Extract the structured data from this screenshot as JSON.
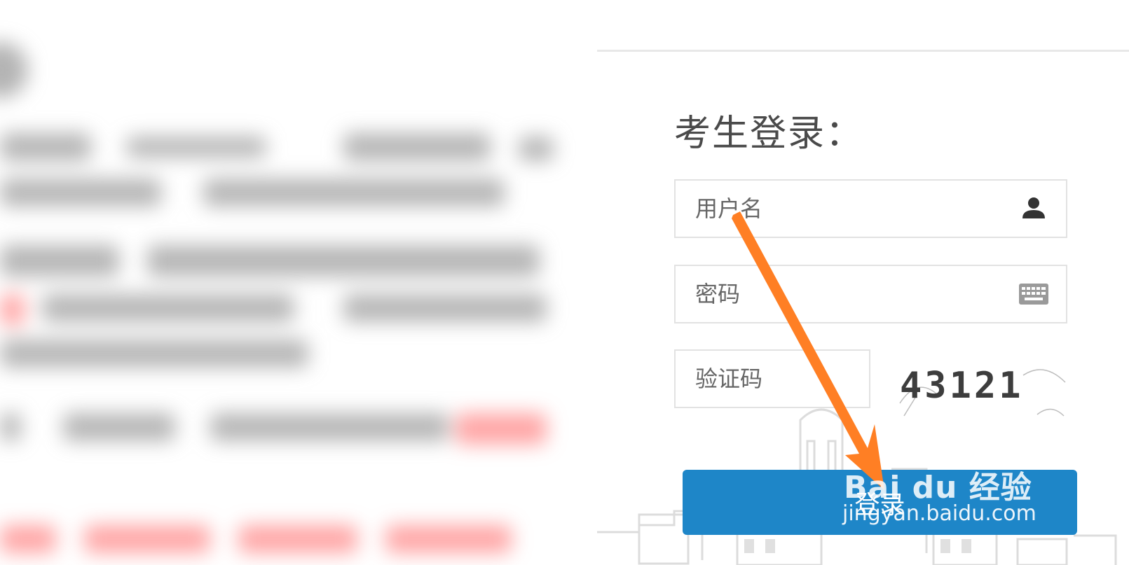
{
  "login": {
    "title": "考生登录：",
    "username_placeholder": "用户名",
    "password_placeholder": "密码",
    "captcha_placeholder": "验证码",
    "captcha_text": "43121",
    "submit_label": "登录"
  },
  "watermark": {
    "brand": "Bai du 经验",
    "url": "jingyan.baidu.com"
  },
  "icons": {
    "username": "user-icon",
    "password": "keyboard-icon"
  },
  "colors": {
    "button": "#1e86c8",
    "arrow": "#ff7f24",
    "field_border": "#e2e2e2"
  }
}
